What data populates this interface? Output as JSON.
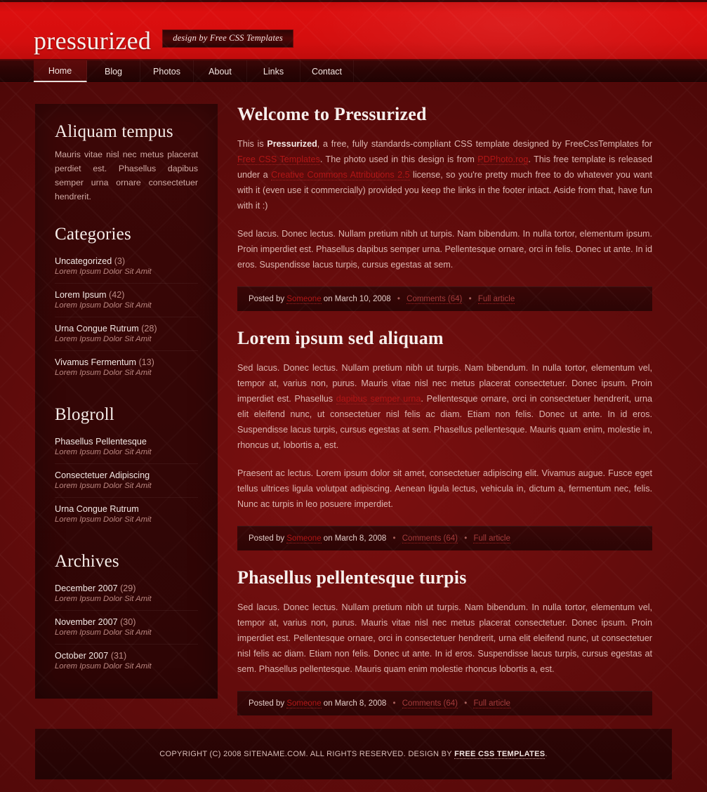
{
  "header": {
    "logo": "pressurized",
    "tagline": "design by Free CSS Templates"
  },
  "nav": {
    "items": [
      {
        "label": "Home",
        "active": true
      },
      {
        "label": "Blog",
        "active": false
      },
      {
        "label": "Photos",
        "active": false
      },
      {
        "label": "About",
        "active": false
      },
      {
        "label": "Links",
        "active": false
      },
      {
        "label": "Contact",
        "active": false
      }
    ]
  },
  "sidebar": {
    "intro": {
      "title": "Aliquam tempus",
      "text": "Mauris vitae nisl nec metus placerat perdiet est. Phasellus dapibus semper urna ornare consectetuer hendrerit."
    },
    "categories": {
      "title": "Categories",
      "items": [
        {
          "label": "Uncategorized",
          "count": "(3)",
          "sub": "Lorem Ipsum Dolor Sit Amit"
        },
        {
          "label": "Lorem Ipsum",
          "count": "(42)",
          "sub": "Lorem Ipsum Dolor Sit Amit"
        },
        {
          "label": "Urna Congue Rutrum",
          "count": "(28)",
          "sub": "Lorem Ipsum Dolor Sit Amit"
        },
        {
          "label": "Vivamus Fermentum",
          "count": "(13)",
          "sub": "Lorem Ipsum Dolor Sit Amit"
        }
      ]
    },
    "blogroll": {
      "title": "Blogroll",
      "items": [
        {
          "label": "Phasellus Pellentesque",
          "count": "",
          "sub": "Lorem Ipsum Dolor Sit Amit"
        },
        {
          "label": "Consectetuer Adipiscing",
          "count": "",
          "sub": "Lorem Ipsum Dolor Sit Amit"
        },
        {
          "label": "Urna Congue Rutrum",
          "count": "",
          "sub": "Lorem Ipsum Dolor Sit Amit"
        }
      ]
    },
    "archives": {
      "title": "Archives",
      "items": [
        {
          "label": "December 2007",
          "count": "(29)",
          "sub": "Lorem Ipsum Dolor Sit Amit"
        },
        {
          "label": "November 2007",
          "count": "(30)",
          "sub": "Lorem Ipsum Dolor Sit Amit"
        },
        {
          "label": "October 2007",
          "count": "(31)",
          "sub": "Lorem Ipsum Dolor Sit Amit"
        }
      ]
    }
  },
  "posts": [
    {
      "title": "Welcome to Pressurized",
      "p1_a": "This is ",
      "p1_strong": "Pressurized",
      "p1_b": ", a free, fully standards-compliant CSS template designed by FreeCssTemplates for ",
      "p1_link1": "Free CSS Templates",
      "p1_c": ". The photo used in this design is from ",
      "p1_link2": "PDPhoto.rog",
      "p1_d": ". This free template is released under a ",
      "p1_link3": "Creative Commons Attributions 2.5",
      "p1_e": " license, so you're pretty much free to do whatever you want with it (even use it commercially) provided you keep the links in the footer intact. Aside from that, have fun with it :)",
      "p2": "Sed lacus. Donec lectus. Nullam pretium nibh ut turpis. Nam bibendum. In nulla tortor, elementum ipsum. Proin imperdiet est. Phasellus dapibus semper urna. Pellentesque ornare, orci in felis. Donec ut ante. In id eros. Suspendisse lacus turpis, cursus egestas at sem.",
      "meta": {
        "posted_by_label": "Posted by",
        "author": "Someone",
        "date": "on March 10, 2008",
        "comments": "Comments (64)",
        "full_article": "Full article",
        "sep": "•"
      }
    },
    {
      "title": "Lorem ipsum sed aliquam",
      "p1_a": "Sed lacus. Donec lectus. Nullam pretium nibh ut turpis. Nam bibendum. In nulla tortor, elementum vel, tempor at, varius non, purus. Mauris vitae nisl nec metus placerat consectetuer. Donec ipsum. Proin imperdiet est. Phasellus ",
      "p1_link1": "dapibus semper urna",
      "p1_b": ". Pellentesque ornare, orci in consectetuer hendrerit, urna elit eleifend nunc, ut consectetuer nisl felis ac diam. Etiam non felis. Donec ut ante. In id eros. Suspendisse lacus turpis, cursus egestas at sem. Phasellus pellentesque. Mauris quam enim, molestie in, rhoncus ut, lobortis a, est.",
      "p2": "Praesent ac lectus. Lorem ipsum dolor sit amet, consectetuer adipiscing elit. Vivamus augue. Fusce eget tellus ultrices ligula volutpat adipiscing. Aenean ligula lectus, vehicula in, dictum a, fermentum nec, felis. Nunc ac turpis in leo posuere imperdiet.",
      "meta": {
        "posted_by_label": "Posted by",
        "author": "Someone",
        "date": "on March 8, 2008",
        "comments": "Comments (64)",
        "full_article": "Full article",
        "sep": "•"
      }
    },
    {
      "title": "Phasellus pellentesque turpis",
      "p1_a": "Sed lacus. Donec lectus. Nullam pretium nibh ut turpis. Nam bibendum. In nulla tortor, elementum vel, tempor at, varius non, purus. Mauris vitae nisl nec metus placerat consectetuer. Donec ipsum. Proin imperdiet est. Pellentesque ornare, orci in consectetuer hendrerit, urna elit eleifend nunc, ut consectetuer nisl felis ac diam. Etiam non felis. Donec ut ante. In id eros. Suspendisse lacus turpis, cursus egestas at sem. Phasellus pellentesque. Mauris quam enim molestie rhoncus lobortis a, est.",
      "meta": {
        "posted_by_label": "Posted by",
        "author": "Someone",
        "date": "on March 8, 2008",
        "comments": "Comments (64)",
        "full_article": "Full article",
        "sep": "•"
      }
    }
  ],
  "footer": {
    "text": "Copyright (c) 2008 sitename.com. All rights reserved. Design by ",
    "link": "Free CSS Templates",
    "suffix": "."
  },
  "colors": {
    "header_red": "#d40e0e",
    "page_bg": "#6b0d0d",
    "panel_bg": "#340606",
    "link": "#b01616",
    "body_text": "#dcb6b0",
    "heading_text": "#f6efec"
  }
}
